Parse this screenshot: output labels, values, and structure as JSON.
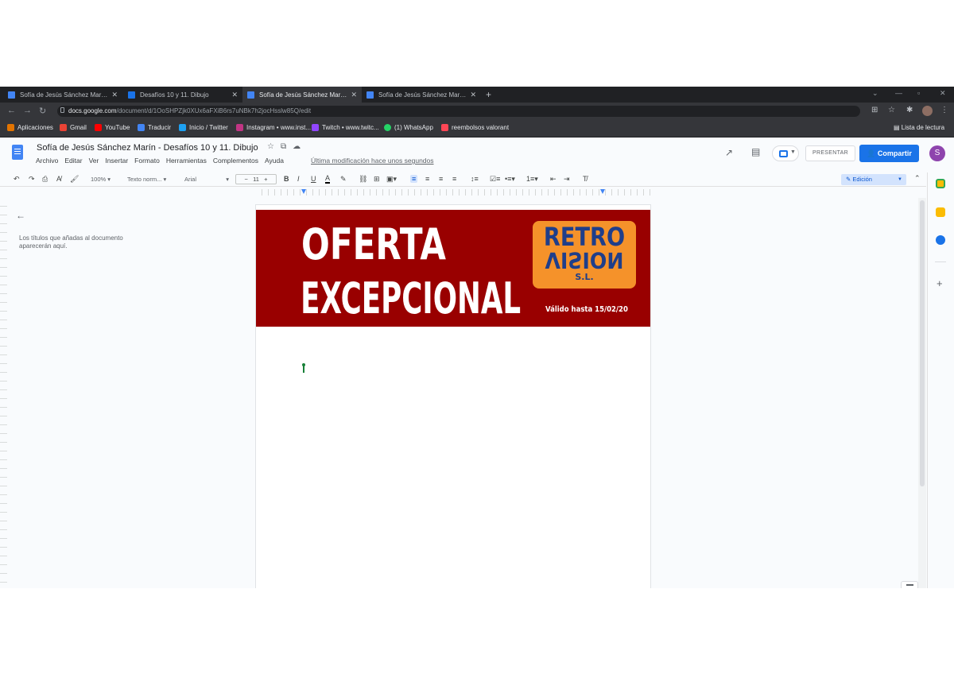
{
  "browser": {
    "tabs": [
      {
        "title": "Sofía de Jesús Sánchez Marín - D",
        "active": false,
        "icon": "docs-icon"
      },
      {
        "title": "Desafíos 10 y 11. Dibujo",
        "active": false,
        "icon": "slides-icon"
      },
      {
        "title": "Sofía de Jesús Sánchez Marín - D",
        "active": true,
        "icon": "docs-icon"
      },
      {
        "title": "Sofía de Jesús Sánchez Marín - D",
        "active": false,
        "icon": "docs-icon"
      }
    ],
    "url_host": "docs.google.com",
    "url_path": "/document/d/1OoSHPZjk0XUx6aFXiB6rs7uNBk7h2jocHsslw85Q/edit",
    "bookmarks": [
      {
        "label": "Aplicaciones",
        "color": "#ea4335"
      },
      {
        "label": "Gmail",
        "color": "#ea4335"
      },
      {
        "label": "YouTube",
        "color": "#ff0000"
      },
      {
        "label": "Traducir",
        "color": "#4285f4"
      },
      {
        "label": "Inicio / Twitter",
        "color": "#1da1f2"
      },
      {
        "label": "Instagram • www.inst...",
        "color": "#c13584"
      },
      {
        "label": "Twitch • www.twitc...",
        "color": "#9146ff"
      },
      {
        "label": "(1) WhatsApp",
        "color": "#25d366"
      },
      {
        "label": "reembolsos valorant",
        "color": "#ff4655"
      }
    ],
    "reading_list": "Lista de lectura"
  },
  "docs": {
    "title": "Sofía de Jesús Sánchez Marín - Desafíos 10 y 11. Dibujo",
    "menu": [
      "Archivo",
      "Editar",
      "Ver",
      "Insertar",
      "Formato",
      "Herramientas",
      "Complementos",
      "Ayuda"
    ],
    "last_edit": "Última modificación hace unos segundos",
    "present_label": "PRESENTAR",
    "share_label": "Compartir",
    "avatar_letter": "S",
    "toolbar": {
      "zoom": "100%",
      "style": "Texto norm...",
      "font": "Arial",
      "font_size": "11",
      "mode": "Edición"
    },
    "outline_hint": "Los títulos que añadas al documento aparecerán aquí."
  },
  "banner": {
    "line1": "OFERTA",
    "line2": "EXCEPCIONAL",
    "logo_top": "RETRO",
    "logo_mirrored": "VISION",
    "logo_suffix": "S.L.",
    "valid_until": "Válido hasta 15/02/20",
    "background": "#990000",
    "logo_color": "#f5922a"
  }
}
